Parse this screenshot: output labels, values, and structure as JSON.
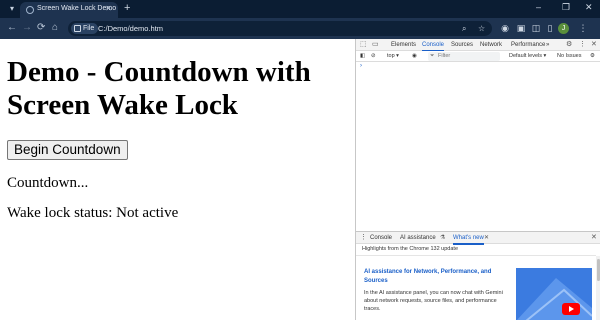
{
  "browser": {
    "tab": {
      "title": "Screen Wake Lock Demo",
      "close": "✕"
    },
    "new_tab": "+",
    "window_controls": {
      "minimize": "–",
      "maximize": "❐",
      "close": "✕"
    },
    "nav": {
      "back": "←",
      "forward": "→",
      "reload": "⟳",
      "home": "⌂"
    },
    "omnibox": {
      "chip": "File",
      "url": "C:/Demo/demo.htm"
    },
    "profile_initial": "J"
  },
  "page": {
    "heading": "Demo - Countdown with Screen Wake Lock",
    "button": "Begin Countdown",
    "countdown": "Countdown...",
    "status": "Wake lock status: Not active"
  },
  "devtools": {
    "tabs": [
      "Elements",
      "Console",
      "Sources",
      "Network",
      "Performance"
    ],
    "more": "»",
    "filterbar": {
      "context": "top ▾",
      "filter_placeholder": "Filter",
      "levels": "Default levels ▾",
      "issues": "No Issues"
    },
    "prompt": "›",
    "drawer": {
      "tabs": [
        "Console",
        "AI assistance",
        "What's new"
      ],
      "subtitle": "Highlights from the Chrome 132 update",
      "card_title": "AI assistance for Network, Performance, and Sources",
      "card_body": "In the AI assistance panel, you can now chat with Gemini about network requests, source files, and performance traces."
    }
  }
}
